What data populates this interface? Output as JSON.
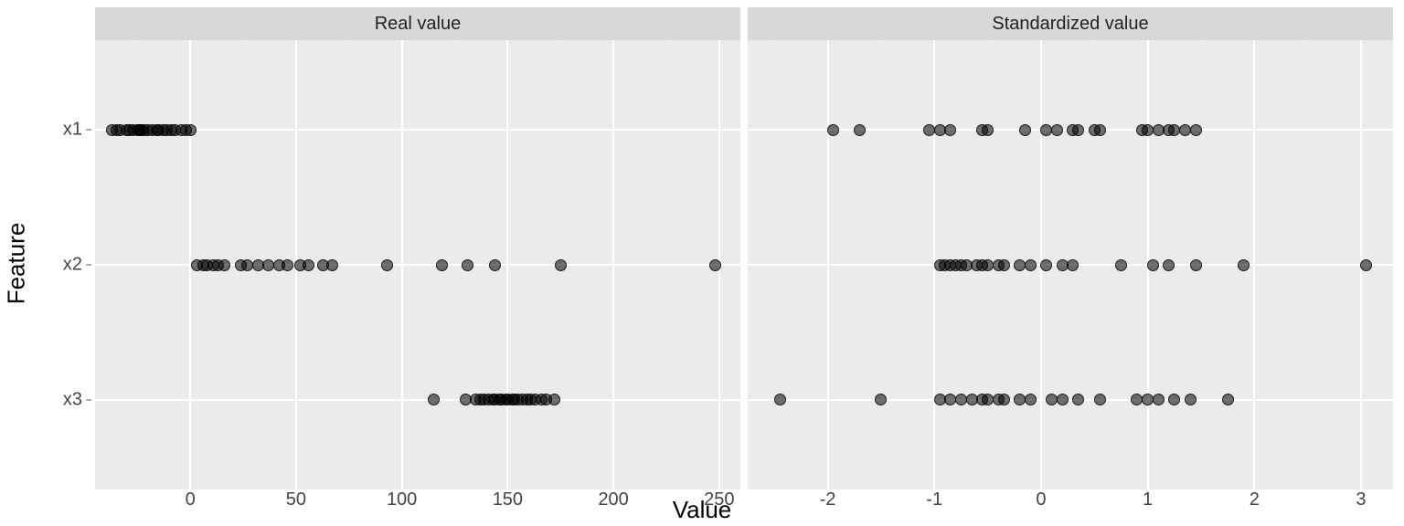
{
  "xlabel": "Value",
  "ylabel": "Feature",
  "y_categories": [
    "x1",
    "x2",
    "x3"
  ],
  "panels": [
    {
      "title": "Real value",
      "xlim": [
        -45,
        260
      ],
      "x_ticks": [
        0,
        50,
        100,
        150,
        200,
        250
      ],
      "x_minor": [
        -25,
        25,
        75,
        125,
        175,
        225
      ]
    },
    {
      "title": "Standardized value",
      "xlim": [
        -2.75,
        3.3
      ],
      "x_ticks": [
        -2,
        -1,
        0,
        1,
        2,
        3
      ],
      "x_minor": [
        -2.5,
        -1.5,
        -0.5,
        0.5,
        1.5,
        2.5
      ]
    }
  ],
  "chart_data": {
    "type": "scatter",
    "ylabel": "Feature",
    "xlabel": "Value",
    "y_categories": [
      "x1",
      "x2",
      "x3"
    ],
    "facets": [
      {
        "name": "Real value",
        "xlim": [
          -45,
          260
        ],
        "series": [
          {
            "name": "x1",
            "values": [
              -37,
              -35,
              -33,
              -30,
              -29,
              -27,
              -25,
              -24,
              -23,
              -22,
              -20,
              -18,
              -16,
              -15,
              -13,
              -11,
              -9,
              -7,
              -4,
              -2,
              0
            ]
          },
          {
            "name": "x2",
            "values": [
              3,
              6,
              8,
              11,
              13,
              16,
              24,
              27,
              32,
              37,
              42,
              46,
              52,
              56,
              63,
              67,
              93,
              119,
              131,
              144,
              175,
              248
            ]
          },
          {
            "name": "x3",
            "values": [
              115,
              130,
              135,
              137,
              139,
              141,
              143,
              144,
              146,
              147,
              149,
              150,
              152,
              153,
              155,
              157,
              159,
              161,
              163,
              166,
              168,
              172
            ]
          }
        ]
      },
      {
        "name": "Standardized value",
        "xlim": [
          -2.75,
          3.3
        ],
        "series": [
          {
            "name": "x1",
            "values": [
              -1.95,
              -1.7,
              -1.05,
              -0.95,
              -0.85,
              -0.55,
              -0.5,
              -0.15,
              0.05,
              0.15,
              0.3,
              0.35,
              0.5,
              0.55,
              0.95,
              1.0,
              1.1,
              1.2,
              1.25,
              1.35,
              1.45
            ]
          },
          {
            "name": "x2",
            "values": [
              -0.95,
              -0.9,
              -0.85,
              -0.8,
              -0.75,
              -0.7,
              -0.6,
              -0.55,
              -0.5,
              -0.4,
              -0.35,
              -0.2,
              -0.1,
              0.05,
              0.2,
              0.3,
              0.75,
              1.05,
              1.2,
              1.45,
              1.9,
              3.05
            ]
          },
          {
            "name": "x3",
            "values": [
              -2.45,
              -1.5,
              -0.95,
              -0.85,
              -0.75,
              -0.65,
              -0.55,
              -0.5,
              -0.4,
              -0.35,
              -0.2,
              -0.1,
              0.1,
              0.2,
              0.35,
              0.55,
              0.9,
              1.0,
              1.1,
              1.25,
              1.4,
              1.75
            ]
          }
        ]
      }
    ]
  }
}
